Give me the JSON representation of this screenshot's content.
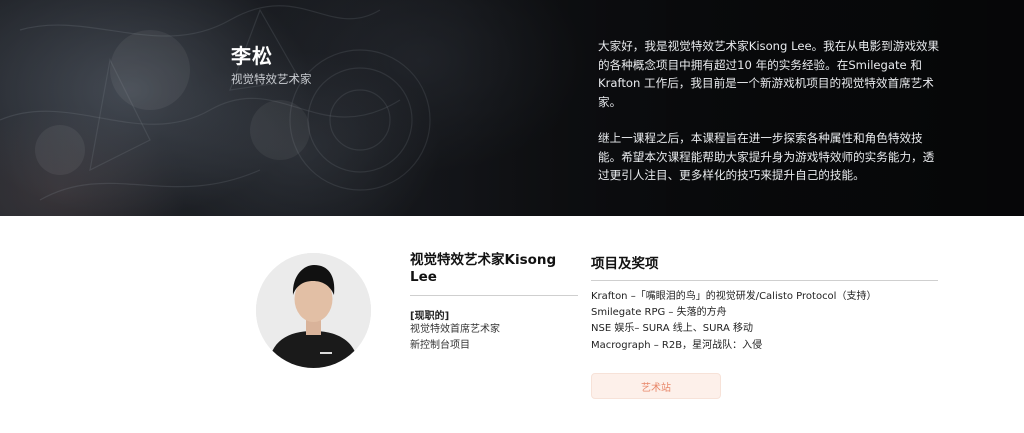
{
  "hero": {
    "name": "李松",
    "role": "视觉特效艺术家",
    "bio": [
      "大家好，我是视觉特效艺术家Kisong Lee。我在从电影到游戏效果的各种概念项目中拥有超过10 年的实务经验。在Smilegate 和 Krafton 工作后，我目前是一个新游戏机项目的视觉特效首席艺术家。",
      "继上一课程之后，本课程旨在进一步探索各种属性和角色特效技能。希望本次课程能帮助大家提升身为游戏特效师的实务能力，透过更引人注目、更多样化的技巧来提升自己的技能。"
    ]
  },
  "profile": {
    "title": "视觉特效艺术家Kisong Lee",
    "current_label": "[现职的]",
    "current_items": [
      "视觉特效首席艺术家",
      "新控制台项目"
    ]
  },
  "projects": {
    "title": "项目及奖项",
    "items": [
      "Krafton –「嘴眼泪的鸟」的视觉研发/Calisto Protocol（支持）",
      "Smilegate RPG – 失落的方舟",
      "NSE 娱乐– SURA 线上、SURA 移动",
      "Macrograph – R2B，星河战队：入侵"
    ],
    "button_label": "艺术站"
  },
  "colors": {
    "button_bg": "#fdf0ea",
    "button_text": "#e8876a"
  },
  "icons": {
    "avatar": "instructor-portrait"
  }
}
